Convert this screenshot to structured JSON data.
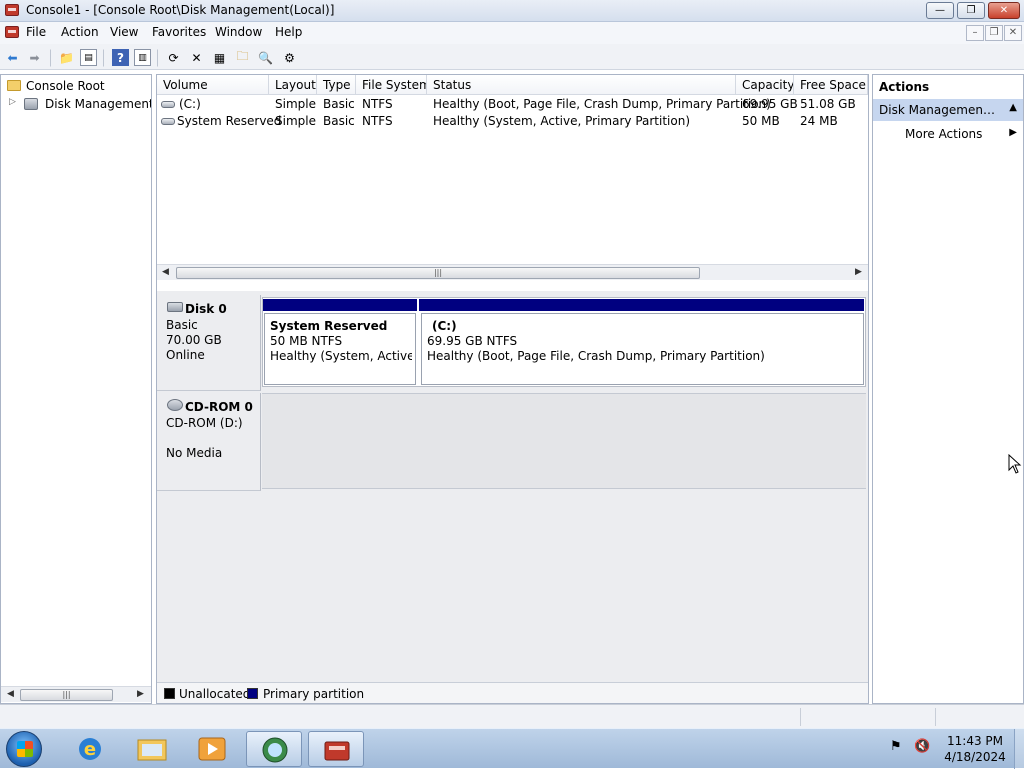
{
  "window": {
    "title": "Console1 - [Console Root\\Disk Management(Local)]"
  },
  "menu": [
    "File",
    "Action",
    "View",
    "Favorites",
    "Window",
    "Help"
  ],
  "toolbar": {
    "icons": [
      "back-arrow-icon",
      "forward-arrow-icon",
      "up-folder-icon",
      "show-hide-tree-icon",
      "help-icon",
      "show-hide-action-pane-icon",
      "refresh-icon",
      "delete-icon",
      "properties-icon",
      "open-folder-icon",
      "search-icon",
      "settings-icon"
    ]
  },
  "tree": {
    "items": [
      {
        "label": "Console Root"
      },
      {
        "label": "Disk Management(Local)"
      }
    ]
  },
  "volumes": {
    "columns": [
      "Volume",
      "Layout",
      "Type",
      "File System",
      "Status",
      "Capacity",
      "Free Space"
    ],
    "rows": [
      [
        "(C:)",
        "Simple",
        "Basic",
        "NTFS",
        "Healthy (Boot, Page File, Crash Dump, Primary Partition)",
        "69.95 GB",
        "51.08 GB"
      ],
      [
        "System Reserved",
        "Simple",
        "Basic",
        "NTFS",
        "Healthy (System, Active, Primary Partition)",
        "50 MB",
        "24 MB"
      ]
    ]
  },
  "disks": [
    {
      "name": "Disk 0",
      "kind": "Basic",
      "size": "70.00 GB",
      "state": "Online",
      "partitions": [
        {
          "name": "System Reserved",
          "size": "50 MB NTFS",
          "status": "Healthy (System, Active, Primary Partition)"
        },
        {
          "name": "(C:)",
          "size": "69.95 GB NTFS",
          "status": "Healthy (Boot, Page File, Crash Dump, Primary Partition)"
        }
      ]
    },
    {
      "name": "CD-ROM 0",
      "kind": "CD-ROM (D:)",
      "state": "No Media"
    }
  ],
  "legend": [
    {
      "label": "Unallocated",
      "color": "#000000"
    },
    {
      "label": "Primary partition",
      "color": "#000080"
    }
  ],
  "actions": {
    "header": "Actions",
    "selected": "Disk Management(Local)",
    "items": [
      "More Actions"
    ]
  },
  "taskbar": {
    "clock_time": "11:43 PM",
    "clock_date": "4/18/2024",
    "apps": [
      "internet-explorer-icon",
      "explorer-folder-icon",
      "media-player-icon",
      "network-globe-icon",
      "computer-management-icon"
    ]
  }
}
